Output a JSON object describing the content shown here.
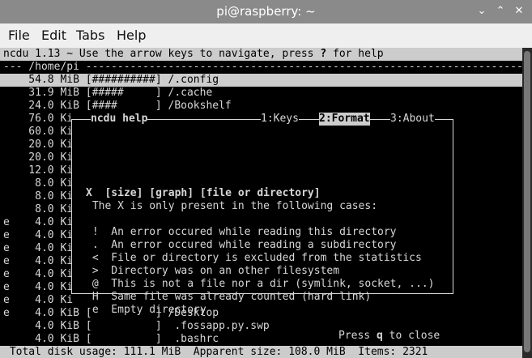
{
  "window": {
    "title": "pi@raspberry: ~"
  },
  "menu": [
    "File",
    "Edit",
    "Tabs",
    "Help"
  ],
  "header": {
    "prefix": "ncdu 1.13 ~ Use the arrow keys to navigate, press ",
    "key": "?",
    "suffix": " for help"
  },
  "path": "--- /home/pi ---------------------------------------------------------------------",
  "rows": [
    {
      "flag": " ",
      "size": "  54.8 MiB",
      "bar": "[##########]",
      "name": " /.config",
      "selected": true
    },
    {
      "flag": " ",
      "size": "  31.9 MiB",
      "bar": "[#####     ]",
      "name": " /.cache"
    },
    {
      "flag": " ",
      "size": "  24.0 KiB",
      "bar": "[####      ]",
      "name": " /Bookshelf"
    },
    {
      "flag": " ",
      "size": "  76.0 Ki"
    },
    {
      "flag": " ",
      "size": "  60.0 Ki"
    },
    {
      "flag": " ",
      "size": "  20.0 Ki"
    },
    {
      "flag": " ",
      "size": "  20.0 Ki"
    },
    {
      "flag": " ",
      "size": "  12.0 Ki"
    },
    {
      "flag": " ",
      "size": "   8.0 Ki"
    },
    {
      "flag": " ",
      "size": "   8.0 Ki"
    },
    {
      "flag": " ",
      "size": "   8.0 Ki"
    },
    {
      "flag": "e",
      "size": "   4.0 Ki"
    },
    {
      "flag": "e",
      "size": "   4.0 Ki"
    },
    {
      "flag": "e",
      "size": "   4.0 Ki"
    },
    {
      "flag": "e",
      "size": "   4.0 Ki"
    },
    {
      "flag": "e",
      "size": "   4.0 Ki"
    },
    {
      "flag": "e",
      "size": "   4.0 Ki"
    },
    {
      "flag": "e",
      "size": "   4.0 Ki"
    },
    {
      "flag": "e",
      "size": "   4.0 KiB",
      "bar": "[          ]",
      "name": " /Desktop"
    },
    {
      "flag": " ",
      "size": "   4.0 KiB",
      "bar": "[          ]",
      "name": "  .fossapp.py.swp"
    },
    {
      "flag": " ",
      "size": "   4.0 KiB",
      "bar": "[          ]",
      "name": "  .bashrc"
    }
  ],
  "footer": " Total disk usage: 111.1 MiB  Apparent size: 108.0 MiB  Items: 2321",
  "help": {
    "title": "ncdu help",
    "tabs": [
      {
        "label": "1:Keys"
      },
      {
        "label": "2:Format",
        "active": true
      },
      {
        "label": "3:About"
      }
    ],
    "format_line": "X  [size] [graph] [file or directory]",
    "intro": " The X is only present in the following cases:",
    "items": [
      {
        "flag": "!",
        "text": "An error occured while reading this directory"
      },
      {
        "flag": ".",
        "text": "An error occured while reading a subdirectory"
      },
      {
        "flag": "<",
        "text": "File or directory is excluded from the statistics"
      },
      {
        "flag": ">",
        "text": "Directory was on an other filesystem"
      },
      {
        "flag": "@",
        "text": "This is not a file nor a dir (symlink, socket, ...)"
      },
      {
        "flag": "H",
        "text": "Same file was already counted (hard link)"
      },
      {
        "flag": "e",
        "text": "Empty directory"
      }
    ],
    "close_prefix": "Press ",
    "close_key": "q",
    "close_suffix": " to close"
  }
}
